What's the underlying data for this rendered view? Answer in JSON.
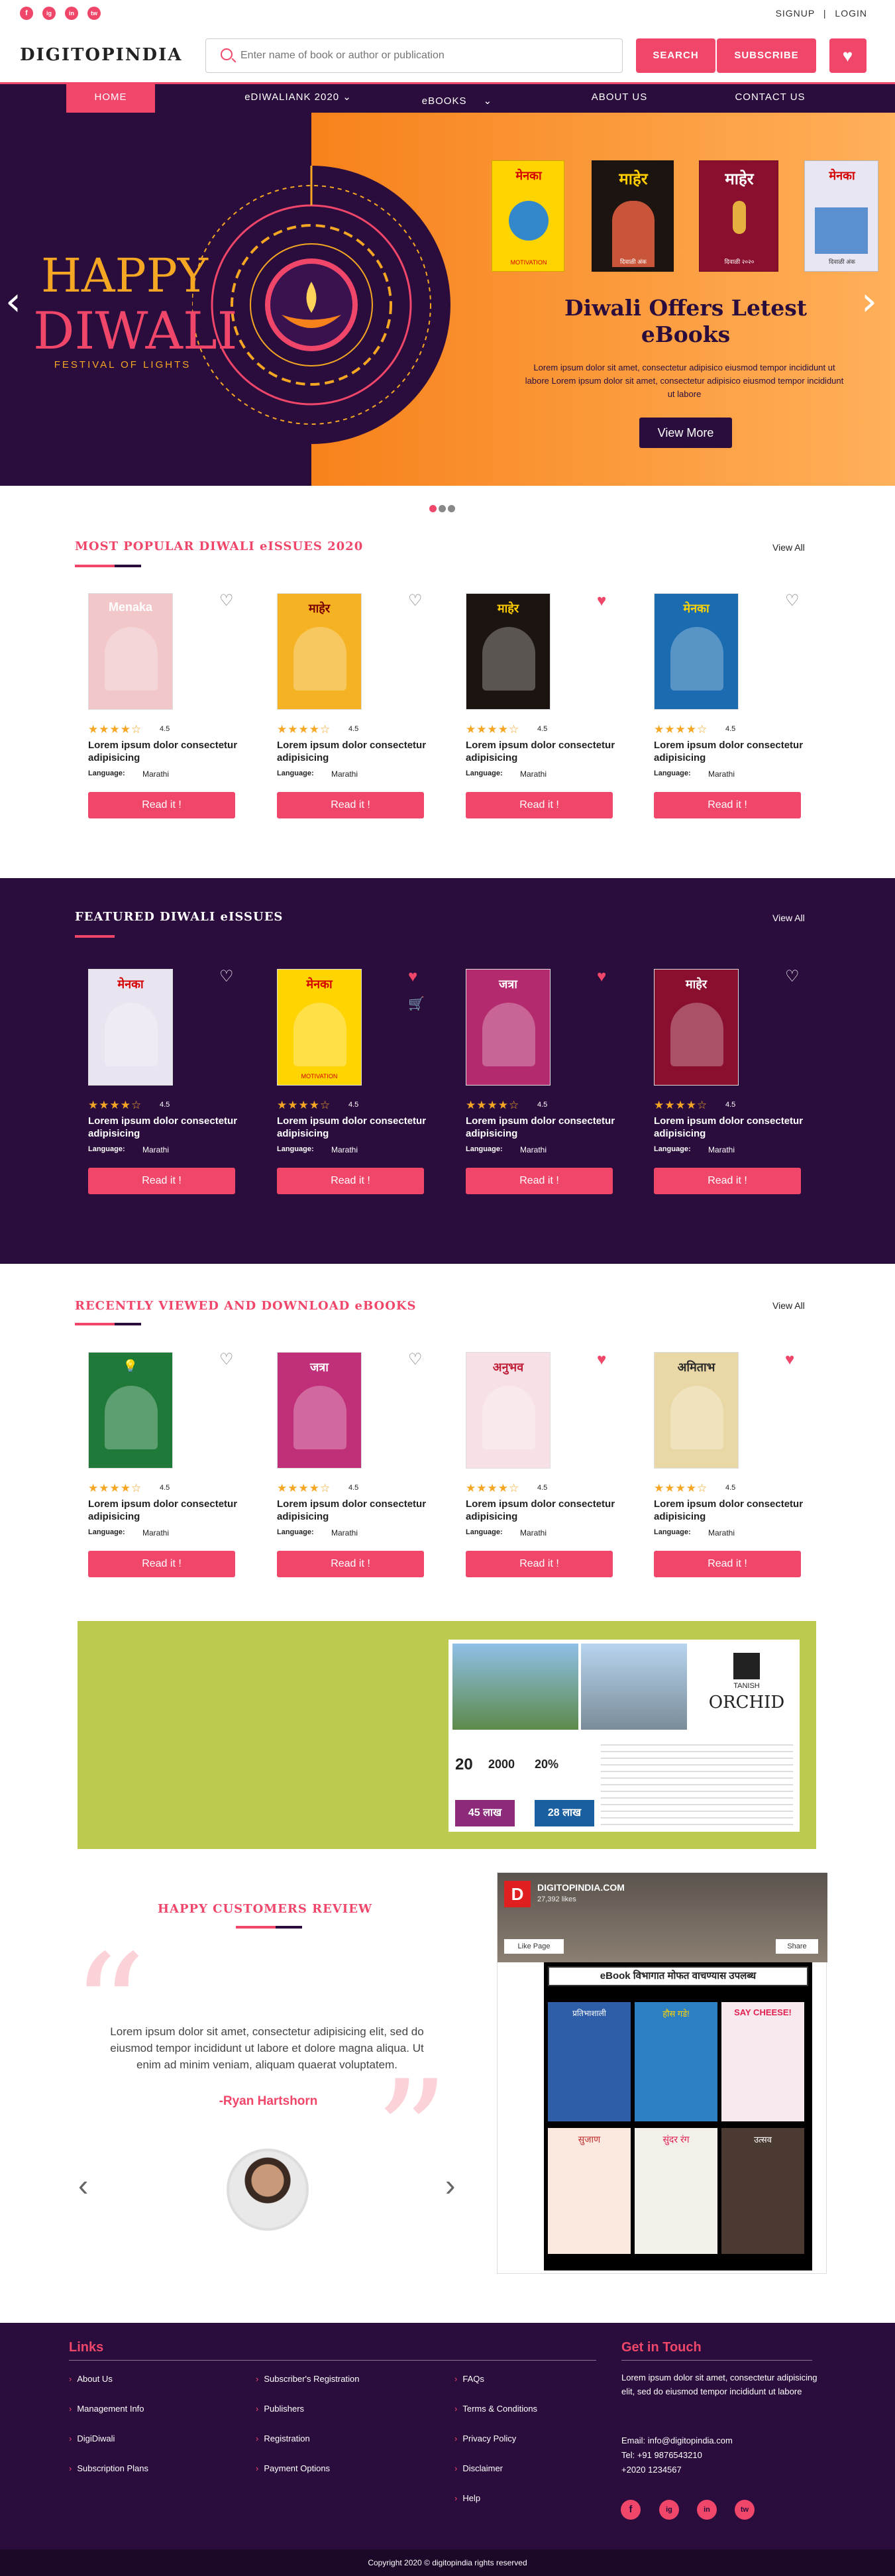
{
  "topbar": {
    "signup": "SIGNUP",
    "sep": "|",
    "login": "LOGIN",
    "social": [
      "f",
      "ig",
      "in",
      "tw"
    ]
  },
  "header": {
    "logo": "DIGITOPINDIA",
    "search_placeholder": "Enter name of book or author or publication",
    "search_button": "SEARCH",
    "subscribe_button": "SUBSCRIBE"
  },
  "nav": {
    "items": [
      "HOME",
      "eDIWALIANK 2020",
      "eBOOKS",
      "ABOUT US",
      "CONTACT US"
    ]
  },
  "hero": {
    "happy": "HAPPY",
    "diwali": "DIWALI",
    "festival": "FESTIVAL OF LIGHTS",
    "title": "Diwali Offers Letest eBooks",
    "description": "Lorem ipsum dolor sit amet, consectetur adipisico eiusmod tempor incididunt ut labore Lorem ipsum dolor sit amet, consectetur adipisico eiusmod tempor incididunt ut labore",
    "button": "View More",
    "prev": "‹",
    "next": "›",
    "covers": [
      {
        "title": "मेनका",
        "sub": "MOTIVATION",
        "bg": "#ffd400",
        "fg": "#d40000"
      },
      {
        "title": "माहेर",
        "sub": "दिवाळी अंक",
        "bg": "#1c1410",
        "fg": "#ffcc00"
      },
      {
        "title": "माहेर",
        "sub": "दिवाळी २०२०",
        "bg": "#8a0f2e",
        "fg": "#ffffff"
      },
      {
        "title": "मेनका",
        "sub": "दिवाळी अंक",
        "bg": "#e7e6f2",
        "fg": "#d40000"
      }
    ]
  },
  "popular": {
    "title": "MOST POPULAR DIWALI eISSUES 2020",
    "view_all": "View All",
    "cards": [
      {
        "cover_title": "Menaka",
        "cover_sub": "",
        "bg": "#f2c7c9",
        "fg": "#ffffff",
        "heart": "♡",
        "heart_color": "#777777",
        "stars": "★★★★☆",
        "rating": "4.5",
        "title": "Lorem ipsum dolor consectetur adipisicing",
        "lang_label": "Language:",
        "lang": "Marathi",
        "button": "Read it !"
      },
      {
        "cover_title": "माहेर",
        "cover_sub": "",
        "bg": "#f5b323",
        "fg": "#7a0000",
        "heart": "♡",
        "heart_color": "#777777",
        "stars": "★★★★☆",
        "rating": "4.5",
        "title": "Lorem ipsum dolor consectetur adipisicing",
        "lang_label": "Language:",
        "lang": "Marathi",
        "button": "Read it !"
      },
      {
        "cover_title": "माहेर",
        "cover_sub": "",
        "bg": "#1c1410",
        "fg": "#ffcc00",
        "heart": "♥",
        "heart_color": "#f0466a",
        "stars": "★★★★☆",
        "rating": "4.5",
        "title": "Lorem ipsum dolor consectetur adipisicing",
        "lang_label": "Language:",
        "lang": "Marathi",
        "button": "Read it !"
      },
      {
        "cover_title": "मेनका",
        "cover_sub": "",
        "bg": "#1a6bb0",
        "fg": "#ffd400",
        "heart": "♡",
        "heart_color": "#777777",
        "stars": "★★★★☆",
        "rating": "4.5",
        "title": "Lorem ipsum dolor consectetur adipisicing",
        "lang_label": "Language:",
        "lang": "Marathi",
        "button": "Read it !"
      }
    ]
  },
  "featured": {
    "title": "FEATURED DIWALI eISSUES",
    "view_all": "View All",
    "cards": [
      {
        "cover_title": "मेनका",
        "cover_sub": "",
        "bg": "#e8e4f0",
        "fg": "#d40000",
        "heart": "♡",
        "heart_color": "#ffffff",
        "stars": "★★★★☆",
        "rating": "4.5",
        "title": "Lorem ipsum dolor consectetur adipisicing",
        "lang_label": "Language:",
        "lang": "Marathi",
        "button": "Read it !"
      },
      {
        "cover_title": "मेनका",
        "cover_sub": "MOTIVATION",
        "bg": "#ffd400",
        "fg": "#d40000",
        "heart": "♥",
        "heart_color": "#f0466a",
        "cart": "🛒",
        "stars": "★★★★☆",
        "rating": "4.5",
        "title": "Lorem ipsum dolor consectetur adipisicing",
        "lang_label": "Language:",
        "lang": "Marathi",
        "button": "Read it !"
      },
      {
        "cover_title": "जत्रा",
        "cover_sub": "",
        "bg": "#b42a6e",
        "fg": "#ffffff",
        "heart": "♥",
        "heart_color": "#f0466a",
        "stars": "★★★★☆",
        "rating": "4.5",
        "title": "Lorem ipsum dolor consectetur adipisicing",
        "lang_label": "Language:",
        "lang": "Marathi",
        "button": "Read it !"
      },
      {
        "cover_title": "माहेर",
        "cover_sub": "",
        "bg": "#8a0f2e",
        "fg": "#ffffff",
        "heart": "♡",
        "heart_color": "#ffffff",
        "stars": "★★★★☆",
        "rating": "4.5",
        "title": "Lorem ipsum dolor consectetur adipisicing",
        "lang_label": "Language:",
        "lang": "Marathi",
        "button": "Read it !"
      }
    ]
  },
  "recent": {
    "title": "RECENTLY VIEWED AND DOWNLOAD eBOOKS",
    "view_all": "View All",
    "cards": [
      {
        "cover_title": "💡",
        "cover_sub": "",
        "bg": "#1f7a3a",
        "fg": "#ffe800",
        "heart": "♡",
        "heart_color": "#777777",
        "stars": "★★★★☆",
        "rating": "4.5",
        "title": "Lorem ipsum dolor consectetur adipisicing",
        "lang_label": "Language:",
        "lang": "Marathi",
        "button": "Read it !"
      },
      {
        "cover_title": "जत्रा",
        "cover_sub": "",
        "bg": "#c0307a",
        "fg": "#ffffff",
        "heart": "♡",
        "heart_color": "#777777",
        "stars": "★★★★☆",
        "rating": "4.5",
        "title": "Lorem ipsum dolor consectetur adipisicing",
        "lang_label": "Language:",
        "lang": "Marathi",
        "button": "Read it !"
      },
      {
        "cover_title": "अनुभव",
        "cover_sub": "",
        "bg": "#f7e1e6",
        "fg": "#c0203a",
        "heart": "♥",
        "heart_color": "#f0466a",
        "stars": "★★★★☆",
        "rating": "4.5",
        "title": "Lorem ipsum dolor consectetur adipisicing",
        "lang_label": "Language:",
        "lang": "Marathi",
        "button": "Read it !"
      },
      {
        "cover_title": "अमिताभ",
        "cover_sub": "",
        "bg": "#e9d8a6",
        "fg": "#2b2b2b",
        "heart": "♥",
        "heart_color": "#f0466a",
        "stars": "★★★★☆",
        "rating": "4.5",
        "title": "Lorem ipsum dolor consectetur adipisicing",
        "lang_label": "Language:",
        "lang": "Marathi",
        "button": "Read it !"
      }
    ]
  },
  "ad": {
    "brand": "ORCHID",
    "brand_top": "TANISH",
    "n1": "20",
    "n2": "2000",
    "n3": "45 लाख",
    "n4": "28 लाख",
    "pct": "20%"
  },
  "review": {
    "title": "HAPPY CUSTOMERS REVIEW",
    "text": "Lorem ipsum dolor sit amet, consectetur adipisicing elit, sed do eiusmod tempor incididunt ut labore et dolore magna aliqua. Ut enim ad minim veniam, aliquam quaerat voluptatem.",
    "author": "-Ryan Hartshorn",
    "prev": "‹",
    "next": "›",
    "open_quote": "“",
    "close_quote": "”"
  },
  "fbwidget": {
    "page": "DIGITOPINDIA.COM",
    "likes": "27,392 likes",
    "like_btn": "Like Page",
    "share_btn": "Share",
    "banner": "eBook विभागात मोफत वाचण्यास उपलब्ध",
    "tiles": [
      "प्रतिभाशाली",
      "हौस गडे!",
      "SAY CHEESE!",
      "सुजाण",
      "सुंदर रंग",
      "उत्सव"
    ]
  },
  "footer": {
    "links_title": "Links",
    "contact_title": "Get in Touch",
    "col1": [
      "About Us",
      "Management Info",
      "DigiDiwali",
      "Subscription Plans"
    ],
    "col2": [
      "Subscriber's Registration",
      "Publishers",
      "Registration",
      "Payment Options"
    ],
    "col3": [
      "FAQs",
      "Terms & Conditions",
      "Privacy Policy",
      "Disclaimer",
      "Help"
    ],
    "contact_text": "Lorem ipsum dolor sit amet, consectetur adipisicing elit, sed do eiusmod tempor incididunt ut labore",
    "email": "Email: info@digitopindia.com",
    "tel": "Tel: +91 9876543210",
    "tel2": "+2020 1234567",
    "social": [
      "f",
      "ig",
      "in",
      "tw"
    ],
    "copyright": "Copyright 2020 © digitopindia rights reserved"
  },
  "colors": {
    "accent": "#f0466a",
    "dark": "#2b0d3d",
    "orange": "#f7821b",
    "lime": "#bccb4f"
  }
}
